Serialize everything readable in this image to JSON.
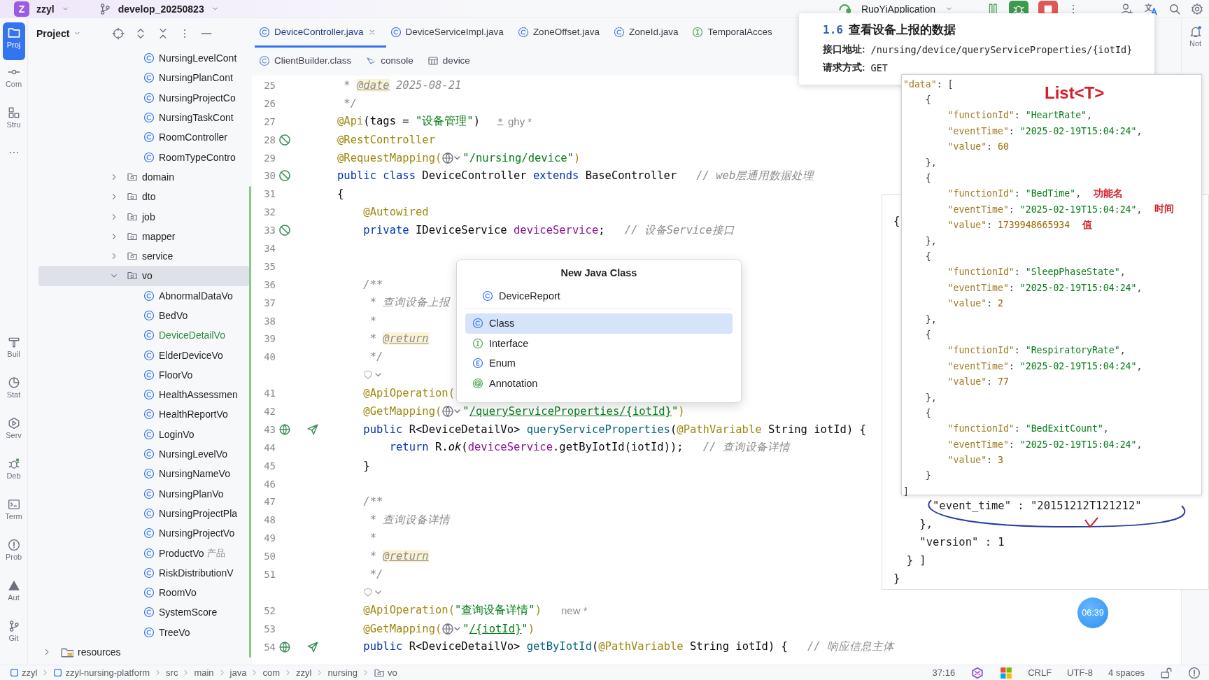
{
  "top_bar": {
    "project": {
      "initial": "Z",
      "name": "zzyl"
    },
    "branch": "develop_20250823",
    "run_config": "RuoYiApplication"
  },
  "tool_strip": {
    "top": [
      {
        "kind": "project",
        "label": "Proj",
        "selected": true
      },
      {
        "kind": "commit",
        "label": "Com",
        "selected": false
      },
      {
        "kind": "structure",
        "label": "Stru",
        "selected": false
      },
      {
        "kind": "more",
        "selected": false
      }
    ],
    "bottom": [
      {
        "kind": "build",
        "label": "Buil",
        "selected": false
      },
      {
        "kind": "statistic",
        "label": "Stat",
        "selected": false
      },
      {
        "kind": "services",
        "label": "Serv",
        "selected": false
      },
      {
        "kind": "debug",
        "label": "Deb",
        "selected": false
      },
      {
        "kind": "terminal",
        "label": "Term",
        "selected": false
      },
      {
        "kind": "problems",
        "label": "Prob",
        "selected": false
      },
      {
        "kind": "auto",
        "label": "Aut",
        "selected": false
      },
      {
        "kind": "git",
        "label": "Git",
        "selected": false
      }
    ]
  },
  "project_panel": {
    "title": "Project",
    "files_above": [
      {
        "label": "NursingLevelCont",
        "selected": false
      },
      {
        "label": "NursingPlanCont",
        "selected": false
      },
      {
        "label": "NursingProjectCo",
        "selected": false
      },
      {
        "label": "NursingTaskCont",
        "selected": false
      },
      {
        "label": "RoomController",
        "selected": false
      },
      {
        "label": "RoomTypeContro",
        "selected": false
      }
    ],
    "folders": [
      {
        "label": "domain",
        "expanded": false,
        "selected": false
      },
      {
        "label": "dto",
        "expanded": false,
        "selected": false
      },
      {
        "label": "job",
        "expanded": false,
        "selected": false
      },
      {
        "label": "mapper",
        "expanded": false,
        "selected": false
      },
      {
        "label": "service",
        "expanded": false,
        "selected": false
      },
      {
        "label": "vo",
        "expanded": true,
        "selected": true,
        "children": [
          {
            "label": "AbnormalDataVo",
            "selected": false,
            "added": false
          },
          {
            "label": "BedVo",
            "selected": false,
            "added": false
          },
          {
            "label": "DeviceDetailVo",
            "selected": false,
            "added": true
          },
          {
            "label": "ElderDeviceVo",
            "selected": false,
            "added": false
          },
          {
            "label": "FloorVo",
            "selected": false,
            "added": false
          },
          {
            "label": "HealthAssessmen",
            "selected": false,
            "added": false
          },
          {
            "label": "HealthReportVo",
            "selected": false,
            "added": false
          },
          {
            "label": "LoginVo",
            "selected": false,
            "added": false
          },
          {
            "label": "NursingLevelVo",
            "selected": false,
            "added": false
          },
          {
            "label": "NursingNameVo",
            "selected": false,
            "added": false
          },
          {
            "label": "NursingPlanVo",
            "selected": false,
            "added": false
          },
          {
            "label": "NursingProjectPla",
            "selected": false,
            "added": false
          },
          {
            "label": "NursingProjectVo",
            "selected": false,
            "added": false
          },
          {
            "label": "ProductVo",
            "hint": "产品",
            "selected": false,
            "added": false
          },
          {
            "label": "RiskDistributionV",
            "selected": false,
            "added": false
          },
          {
            "label": "RoomVo",
            "selected": false,
            "added": false
          },
          {
            "label": "SystemScore",
            "selected": false,
            "added": false
          },
          {
            "label": "TreeVo",
            "selected": false,
            "added": false
          }
        ]
      }
    ],
    "resources": {
      "label": "resources",
      "expanded": false,
      "selected": false
    }
  },
  "editor": {
    "tabs": [
      {
        "kind": "class",
        "label": "DeviceController.java",
        "selected": true
      },
      {
        "kind": "class",
        "label": "DeviceServiceImpl.java",
        "selected": false
      },
      {
        "kind": "class-lib",
        "label": "ZoneOffset.java",
        "selected": false
      },
      {
        "kind": "class-lib",
        "label": "ZoneId.java",
        "selected": false
      },
      {
        "kind": "interface",
        "label": "TemporalAcces",
        "selected": false
      }
    ],
    "tabs_row2": [
      {
        "kind": "class-file",
        "label": "ClientBuilder.class",
        "selected": false
      },
      {
        "kind": "console",
        "label": "console",
        "selected": false
      },
      {
        "kind": "table",
        "label": "device",
        "selected": false
      }
    ],
    "lines": [
      {
        "kind": "code",
        "number": "25",
        "tokens": [
          {
            "kind": "comment",
            "text": " * "
          },
          {
            "kind": "doctag",
            "text": "@date"
          },
          {
            "kind": "comment",
            "text": " 2025-08-21"
          }
        ]
      },
      {
        "kind": "code",
        "number": "26",
        "tokens": [
          {
            "kind": "comment",
            "text": " */"
          }
        ]
      },
      {
        "kind": "code",
        "number": "27",
        "tokens": [
          {
            "kind": "annotation",
            "text": "@Api"
          },
          {
            "kind": "plain",
            "text": "(tags = "
          },
          {
            "kind": "string",
            "text": "\"设备管理\""
          },
          {
            "kind": "plain",
            "text": ")"
          },
          {
            "kind": "author",
            "text": "ghy *"
          }
        ]
      },
      {
        "kind": "code",
        "number": "28",
        "marks": [
          {
            "kind": "bean"
          }
        ],
        "tokens": [
          {
            "kind": "annotation",
            "text": "@RestController"
          }
        ]
      },
      {
        "kind": "code",
        "number": "29",
        "tokens": [
          {
            "kind": "annotation",
            "text": "@RequestMapping("
          },
          {
            "kind": "globe"
          },
          {
            "kind": "string",
            "text": "\"/nursing/device\""
          },
          {
            "kind": "annotation",
            "text": ")"
          }
        ]
      },
      {
        "kind": "code",
        "number": "30",
        "marks": [
          {
            "kind": "bean"
          }
        ],
        "tokens": [
          {
            "kind": "keyword",
            "text": "public class "
          },
          {
            "kind": "plain",
            "text": "DeviceController "
          },
          {
            "kind": "keyword",
            "text": "extends "
          },
          {
            "kind": "plain",
            "text": "BaseController"
          },
          {
            "kind": "comment",
            "text": "   // web层通用数据处理"
          }
        ]
      },
      {
        "kind": "code",
        "number": "31",
        "tokens": [
          {
            "kind": "plain",
            "text": "{"
          }
        ]
      },
      {
        "kind": "code",
        "number": "32",
        "tokens": [
          {
            "kind": "annotation",
            "text": "    @Autowired"
          }
        ]
      },
      {
        "kind": "code",
        "number": "33",
        "marks": [
          {
            "kind": "bean"
          }
        ],
        "tokens": [
          {
            "kind": "keyword",
            "text": "    private "
          },
          {
            "kind": "plain",
            "text": "IDeviceService "
          },
          {
            "kind": "field",
            "text": "deviceService"
          },
          {
            "kind": "plain",
            "text": ";"
          },
          {
            "kind": "comment",
            "text": "   // 设备Service接口"
          }
        ]
      },
      {
        "kind": "code",
        "number": "34"
      },
      {
        "kind": "code",
        "number": "35"
      },
      {
        "kind": "code",
        "number": "36",
        "tokens": [
          {
            "kind": "comment",
            "text": "    /**"
          }
        ]
      },
      {
        "kind": "code",
        "number": "37",
        "tokens": [
          {
            "kind": "comment",
            "text": "     * 查询设备上报"
          }
        ]
      },
      {
        "kind": "code",
        "number": "38",
        "tokens": [
          {
            "kind": "comment",
            "text": "     *"
          }
        ]
      },
      {
        "kind": "code",
        "number": "39",
        "tokens": [
          {
            "kind": "comment",
            "text": "     * "
          },
          {
            "kind": "doctag",
            "text": "@return"
          }
        ]
      },
      {
        "kind": "code",
        "number": "40",
        "tokens": [
          {
            "kind": "comment",
            "text": "     */"
          }
        ]
      },
      {
        "kind": "fold"
      },
      {
        "kind": "code",
        "number": "41",
        "tokens": [
          {
            "kind": "annotation",
            "text": "    @ApiOperation("
          }
        ]
      },
      {
        "kind": "code",
        "number": "42",
        "tokens": [
          {
            "kind": "annotation",
            "text": "    @GetMapping("
          },
          {
            "kind": "globe"
          },
          {
            "kind": "string",
            "text": "\""
          },
          {
            "kind": "url",
            "text": "/queryServiceProperties/{iotId}"
          },
          {
            "kind": "string",
            "text": "\""
          },
          {
            "kind": "annotation",
            "text": ")"
          }
        ]
      },
      {
        "kind": "code",
        "number": "43",
        "marks": [
          {
            "kind": "web"
          },
          {
            "kind": "send"
          }
        ],
        "tokens": [
          {
            "kind": "keyword",
            "text": "    public "
          },
          {
            "kind": "plain",
            "text": "R<DeviceDetailVo> "
          },
          {
            "kind": "method",
            "text": "queryServiceProperties"
          },
          {
            "kind": "plain",
            "text": "("
          },
          {
            "kind": "annotation",
            "text": "@PathVariable"
          },
          {
            "kind": "plain",
            "text": " String iotId) {"
          }
        ]
      },
      {
        "kind": "code",
        "number": "44",
        "tokens": [
          {
            "kind": "keyword",
            "text": "        return "
          },
          {
            "kind": "plain",
            "text": "R."
          },
          {
            "kind": "static",
            "text": "ok"
          },
          {
            "kind": "plain",
            "text": "("
          },
          {
            "kind": "field",
            "text": "deviceService"
          },
          {
            "kind": "plain",
            "text": ".getByIotId(iotId));"
          },
          {
            "kind": "comment",
            "text": "   // 查询设备详情"
          }
        ]
      },
      {
        "kind": "code",
        "number": "45",
        "tokens": [
          {
            "kind": "plain",
            "text": "    }"
          }
        ]
      },
      {
        "kind": "code",
        "number": "46"
      },
      {
        "kind": "code",
        "number": "47",
        "tokens": [
          {
            "kind": "comment",
            "text": "    /**"
          }
        ]
      },
      {
        "kind": "code",
        "number": "48",
        "tokens": [
          {
            "kind": "comment",
            "text": "     * 查询设备详情"
          }
        ]
      },
      {
        "kind": "code",
        "number": "49",
        "tokens": [
          {
            "kind": "comment",
            "text": "     *"
          }
        ]
      },
      {
        "kind": "code",
        "number": "50",
        "tokens": [
          {
            "kind": "comment",
            "text": "     * "
          },
          {
            "kind": "doctag",
            "text": "@return"
          }
        ]
      },
      {
        "kind": "code",
        "number": "51",
        "tokens": [
          {
            "kind": "comment",
            "text": "     */"
          }
        ]
      },
      {
        "kind": "fold"
      },
      {
        "kind": "code",
        "number": "52",
        "tokens": [
          {
            "kind": "annotation",
            "text": "    @ApiOperation("
          },
          {
            "kind": "string",
            "text": "\"查询设备详情\""
          },
          {
            "kind": "annotation",
            "text": ")"
          },
          {
            "kind": "hint",
            "text": "new *"
          }
        ]
      },
      {
        "kind": "code",
        "number": "53",
        "tokens": [
          {
            "kind": "annotation",
            "text": "    @GetMapping("
          },
          {
            "kind": "globe"
          },
          {
            "kind": "string",
            "text": "\""
          },
          {
            "kind": "url",
            "text": "/{iotId}"
          },
          {
            "kind": "string",
            "text": "\""
          },
          {
            "kind": "annotation",
            "text": ")"
          }
        ]
      },
      {
        "kind": "code",
        "number": "54",
        "marks": [
          {
            "kind": "web"
          },
          {
            "kind": "send"
          }
        ],
        "tokens": [
          {
            "kind": "keyword",
            "text": "    public "
          },
          {
            "kind": "plain",
            "text": "R<DeviceDetailVo> "
          },
          {
            "kind": "method",
            "text": "getByIotId"
          },
          {
            "kind": "plain",
            "text": "("
          },
          {
            "kind": "annotation",
            "text": "@PathVariable"
          },
          {
            "kind": "plain",
            "text": " String iotId) {"
          },
          {
            "kind": "comment",
            "text": "   // 响应信息主体"
          }
        ]
      }
    ]
  },
  "right_strip": {
    "label": "Not"
  },
  "doc_popup": {
    "section": "1.6",
    "title": "查看设备上报的数据",
    "address_label": "接口地址:",
    "address": "/nursing/device/queryServiceProperties/{iotId}",
    "method_label": "请求方式:",
    "method": "GET"
  },
  "response_card": {
    "top_line": "{",
    "bottom_lines": [
      "      \"event_time\" : \"20151212T121212\"",
      "    },",
      "    \"version\" : 1",
      "  } ]",
      "}"
    ]
  },
  "response_image": {
    "note": "List<T>",
    "lines": [
      {
        "tokens": [
          {
            "kind": "key",
            "text": "\"data\""
          },
          {
            "kind": "punct",
            "text": ": ["
          }
        ]
      },
      {
        "tokens": [
          {
            "kind": "punct",
            "text": "    {"
          }
        ]
      },
      {
        "tokens": [
          {
            "kind": "key",
            "text": "        \"functionId\""
          },
          {
            "kind": "punct",
            "text": ": "
          },
          {
            "kind": "string",
            "text": "\"HeartRate\""
          },
          {
            "kind": "punct",
            "text": ","
          }
        ]
      },
      {
        "tokens": [
          {
            "kind": "key",
            "text": "        \"eventTime\""
          },
          {
            "kind": "punct",
            "text": ": "
          },
          {
            "kind": "string",
            "text": "\"2025-02-19T15:04:24\""
          },
          {
            "kind": "punct",
            "text": ","
          }
        ]
      },
      {
        "tokens": [
          {
            "kind": "key",
            "text": "        \"value\""
          },
          {
            "kind": "punct",
            "text": ": "
          },
          {
            "kind": "number",
            "text": "60"
          }
        ]
      },
      {
        "tokens": [
          {
            "kind": "punct",
            "text": "    },"
          }
        ]
      },
      {
        "tokens": [
          {
            "kind": "punct",
            "text": "    {"
          }
        ]
      },
      {
        "tokens": [
          {
            "kind": "key",
            "text": "        \"functionId\""
          },
          {
            "kind": "punct",
            "text": ": "
          },
          {
            "kind": "string",
            "text": "\"BedTime\""
          },
          {
            "kind": "punct",
            "text": ","
          }
        ],
        "note": "功能名"
      },
      {
        "tokens": [
          {
            "kind": "key",
            "text": "        \"eventTime\""
          },
          {
            "kind": "punct",
            "text": ": "
          },
          {
            "kind": "string",
            "text": "\"2025-02-19T15:04:24\""
          },
          {
            "kind": "punct",
            "text": ","
          }
        ],
        "note": "时间"
      },
      {
        "tokens": [
          {
            "kind": "key",
            "text": "        \"value\""
          },
          {
            "kind": "punct",
            "text": ": "
          },
          {
            "kind": "number",
            "text": "1739948665934"
          }
        ],
        "note": "值"
      },
      {
        "tokens": [
          {
            "kind": "punct",
            "text": "    },"
          }
        ]
      },
      {
        "tokens": [
          {
            "kind": "punct",
            "text": "    {"
          }
        ]
      },
      {
        "tokens": [
          {
            "kind": "key",
            "text": "        \"functionId\""
          },
          {
            "kind": "punct",
            "text": ": "
          },
          {
            "kind": "string",
            "text": "\"SleepPhaseState\""
          },
          {
            "kind": "punct",
            "text": ","
          }
        ]
      },
      {
        "tokens": [
          {
            "kind": "key",
            "text": "        \"eventTime\""
          },
          {
            "kind": "punct",
            "text": ": "
          },
          {
            "kind": "string",
            "text": "\"2025-02-19T15:04:24\""
          },
          {
            "kind": "punct",
            "text": ","
          }
        ]
      },
      {
        "tokens": [
          {
            "kind": "key",
            "text": "        \"value\""
          },
          {
            "kind": "punct",
            "text": ": "
          },
          {
            "kind": "number",
            "text": "2"
          }
        ]
      },
      {
        "tokens": [
          {
            "kind": "punct",
            "text": "    },"
          }
        ]
      },
      {
        "tokens": [
          {
            "kind": "punct",
            "text": "    {"
          }
        ]
      },
      {
        "tokens": [
          {
            "kind": "key",
            "text": "        \"functionId\""
          },
          {
            "kind": "punct",
            "text": ": "
          },
          {
            "kind": "string",
            "text": "\"RespiratoryRate\""
          },
          {
            "kind": "punct",
            "text": ","
          }
        ]
      },
      {
        "tokens": [
          {
            "kind": "key",
            "text": "        \"eventTime\""
          },
          {
            "kind": "punct",
            "text": ": "
          },
          {
            "kind": "string",
            "text": "\"2025-02-19T15:04:24\""
          },
          {
            "kind": "punct",
            "text": ","
          }
        ]
      },
      {
        "tokens": [
          {
            "kind": "key",
            "text": "        \"value\""
          },
          {
            "kind": "punct",
            "text": ": "
          },
          {
            "kind": "number",
            "text": "77"
          }
        ]
      },
      {
        "tokens": [
          {
            "kind": "punct",
            "text": "    },"
          }
        ]
      },
      {
        "tokens": [
          {
            "kind": "punct",
            "text": "    {"
          }
        ]
      },
      {
        "tokens": [
          {
            "kind": "key",
            "text": "        \"functionId\""
          },
          {
            "kind": "punct",
            "text": ": "
          },
          {
            "kind": "string",
            "text": "\"BedExitCount\""
          },
          {
            "kind": "punct",
            "text": ","
          }
        ]
      },
      {
        "tokens": [
          {
            "kind": "key",
            "text": "        \"eventTime\""
          },
          {
            "kind": "punct",
            "text": ": "
          },
          {
            "kind": "string",
            "text": "\"2025-02-19T15:04:24\""
          },
          {
            "kind": "punct",
            "text": ","
          }
        ]
      },
      {
        "tokens": [
          {
            "kind": "key",
            "text": "        \"value\""
          },
          {
            "kind": "punct",
            "text": ": "
          },
          {
            "kind": "number",
            "text": "3"
          }
        ]
      },
      {
        "tokens": [
          {
            "kind": "punct",
            "text": "    }"
          }
        ]
      },
      {
        "tokens": [
          {
            "kind": "punct",
            "text": "]"
          }
        ]
      }
    ]
  },
  "new_class_dialog": {
    "title": "New Java Class",
    "name": "DeviceReport",
    "options": [
      {
        "kind": "class",
        "label": "Class",
        "selected": true
      },
      {
        "kind": "interface",
        "label": "Interface",
        "selected": false
      },
      {
        "kind": "enum",
        "label": "Enum",
        "selected": false
      },
      {
        "kind": "annotation",
        "label": "Annotation",
        "selected": false
      }
    ]
  },
  "timer_badge": "06:39",
  "status_bar": {
    "path": [
      {
        "kind": "module",
        "label": "zzyl"
      },
      {
        "kind": "module",
        "label": "zzyl-nursing-platform"
      },
      {
        "kind": "dir",
        "label": "src"
      },
      {
        "kind": "dir",
        "label": "main"
      },
      {
        "kind": "dir",
        "label": "java"
      },
      {
        "kind": "dir",
        "label": "com"
      },
      {
        "kind": "dir",
        "label": "zzyl"
      },
      {
        "kind": "dir",
        "label": "nursing"
      },
      {
        "kind": "package",
        "label": "vo"
      }
    ],
    "position": "37:16",
    "line_ending": "CRLF",
    "encoding": "UTF-8",
    "indent": "4 spaces"
  }
}
